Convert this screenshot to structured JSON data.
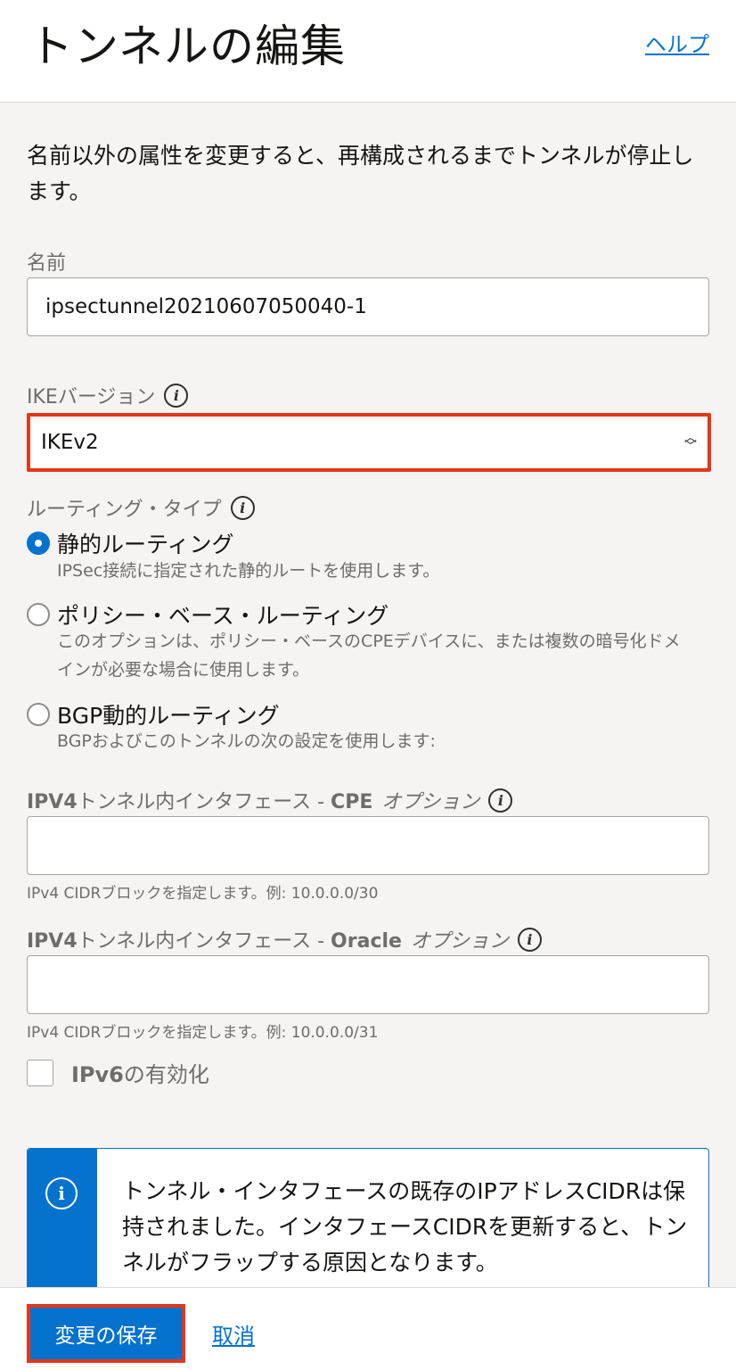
{
  "header": {
    "title": "トンネルの編集",
    "help_label": "ヘルプ"
  },
  "intro": "名前以外の属性を変更すると、再構成されるまでトンネルが停止します。",
  "name_field": {
    "label": "名前",
    "value": "ipsectunnel20210607050040-1"
  },
  "ike_version": {
    "label": "IKEバージョン",
    "selected": "IKEv2"
  },
  "routing_type": {
    "label": "ルーティング・タイプ",
    "options": [
      {
        "label": "静的ルーティング",
        "description": "IPSec接続に指定された静的ルートを使用します。",
        "checked": true
      },
      {
        "label": "ポリシー・ベース・ルーティング",
        "description": "このオプションは、ポリシー・ベースのCPEデバイスに、または複数の暗号化ドメ",
        "description2": "インが必要な場合に使用します。",
        "checked": false
      },
      {
        "label": "BGP動的ルーティング",
        "description": "BGPおよびこのトンネルの次の設定を使用します:",
        "checked": false
      }
    ]
  },
  "ipv4_cpe": {
    "label_bold": "IPV4",
    "label_rest": "トンネル内インタフェース - ",
    "label_bold2": "CPE",
    "optional": "オプション",
    "value": "",
    "hint": "IPv4 CIDRブロックを指定します。例: 10.0.0.0/30"
  },
  "ipv4_oracle": {
    "label_bold": "IPV4",
    "label_rest": "トンネル内インタフェース - ",
    "label_bold2": "Oracle",
    "optional": "オプション",
    "value": "",
    "hint": "IPv4 CIDRブロックを指定します。例: 10.0.0.0/31"
  },
  "ipv6": {
    "label_bold": "IPv6",
    "label_rest": "の有効化",
    "checked": false
  },
  "info_box": {
    "message": "トンネル・インタフェースの既存のIPアドレスCIDRは保持されました。インタフェースCIDRを更新すると、トンネルがフラップする原因となります。"
  },
  "footer": {
    "save_label": "変更の保存",
    "cancel_label": "取消"
  },
  "colors": {
    "accent": "#0572ce",
    "highlight": "#e4361b"
  }
}
